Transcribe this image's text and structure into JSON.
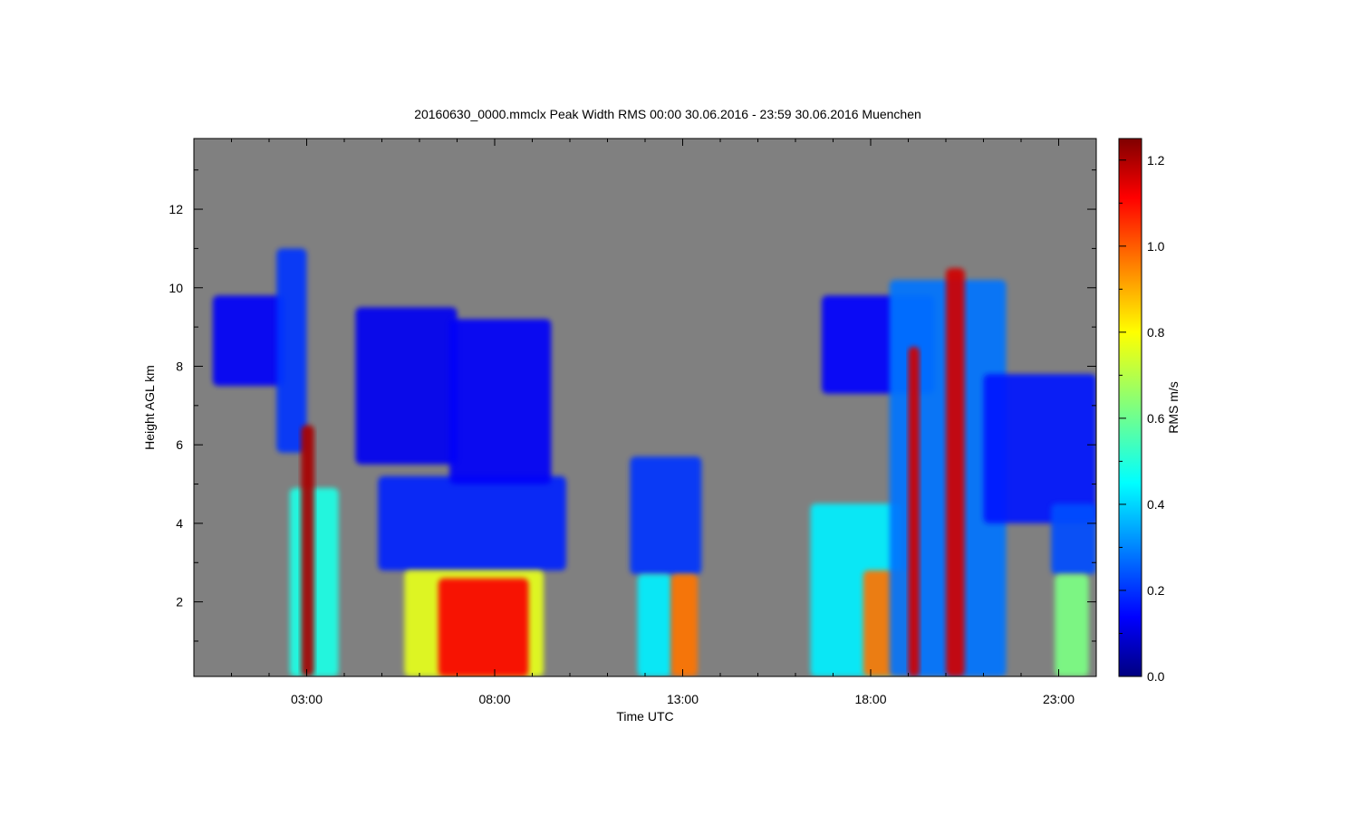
{
  "chart_data": {
    "type": "heatmap",
    "title": "20160630_0000.mmclx Peak Width RMS   00:00 30.06.2016 - 23:59 30.06.2016 Muenchen",
    "xlabel": "Time UTC",
    "ylabel": "Height AGL km",
    "x_ticks": [
      {
        "value": 3,
        "label": "03:00"
      },
      {
        "value": 8,
        "label": "08:00"
      },
      {
        "value": 13,
        "label": "13:00"
      },
      {
        "value": 18,
        "label": "18:00"
      },
      {
        "value": 23,
        "label": "23:00"
      }
    ],
    "y_ticks": [
      {
        "value": 2,
        "label": "2"
      },
      {
        "value": 4,
        "label": "4"
      },
      {
        "value": 6,
        "label": "6"
      },
      {
        "value": 8,
        "label": "8"
      },
      {
        "value": 10,
        "label": "10"
      },
      {
        "value": 12,
        "label": "12"
      }
    ],
    "xlim": [
      0,
      24
    ],
    "ylim": [
      0.1,
      13.8
    ],
    "background_color": "#808080",
    "colorbar": {
      "label": "RMS m/s",
      "range": [
        0.0,
        1.25
      ],
      "ticks": [
        {
          "value": 0.0,
          "label": "0.0"
        },
        {
          "value": 0.2,
          "label": "0.2"
        },
        {
          "value": 0.4,
          "label": "0.4"
        },
        {
          "value": 0.6,
          "label": "0.6"
        },
        {
          "value": 0.8,
          "label": "0.8"
        },
        {
          "value": 1.0,
          "label": "1.0"
        },
        {
          "value": 1.2,
          "label": "1.2"
        }
      ],
      "colormap": "jet"
    },
    "echo_regions": [
      {
        "t0": 0.5,
        "t1": 2.4,
        "h0": 7.5,
        "h1": 9.8,
        "rms": 0.15
      },
      {
        "t0": 2.2,
        "t1": 3.0,
        "h0": 5.8,
        "h1": 11.0,
        "rms": 0.22
      },
      {
        "t0": 2.55,
        "t1": 3.85,
        "h0": 0.1,
        "h1": 4.9,
        "rms": 0.5
      },
      {
        "t0": 2.85,
        "t1": 3.2,
        "h0": 0.1,
        "h1": 6.5,
        "rms": 1.2
      },
      {
        "t0": 4.3,
        "t1": 7.0,
        "h0": 5.5,
        "h1": 9.5,
        "rms": 0.14
      },
      {
        "t0": 4.9,
        "t1": 9.9,
        "h0": 2.8,
        "h1": 5.2,
        "rms": 0.2
      },
      {
        "t0": 6.8,
        "t1": 9.5,
        "h0": 5.0,
        "h1": 9.2,
        "rms": 0.15
      },
      {
        "t0": 5.6,
        "t1": 9.3,
        "h0": 0.1,
        "h1": 2.8,
        "rms": 0.75
      },
      {
        "t0": 6.5,
        "t1": 8.9,
        "h0": 0.1,
        "h1": 2.6,
        "rms": 1.1
      },
      {
        "t0": 11.6,
        "t1": 13.5,
        "h0": 2.7,
        "h1": 5.7,
        "rms": 0.22
      },
      {
        "t0": 11.8,
        "t1": 12.7,
        "h0": 0.1,
        "h1": 2.7,
        "rms": 0.45
      },
      {
        "t0": 12.7,
        "t1": 13.4,
        "h0": 0.1,
        "h1": 2.7,
        "rms": 0.95
      },
      {
        "t0": 16.7,
        "t1": 19.7,
        "h0": 7.3,
        "h1": 9.8,
        "rms": 0.16
      },
      {
        "t0": 16.4,
        "t1": 18.8,
        "h0": 0.1,
        "h1": 4.5,
        "rms": 0.45
      },
      {
        "t0": 17.8,
        "t1": 19.2,
        "h0": 0.1,
        "h1": 2.8,
        "rms": 0.95
      },
      {
        "t0": 18.5,
        "t1": 21.6,
        "h0": 0.1,
        "h1": 10.2,
        "rms": 0.3
      },
      {
        "t0": 19.0,
        "t1": 19.3,
        "h0": 0.1,
        "h1": 8.5,
        "rms": 1.15
      },
      {
        "t0": 20.0,
        "t1": 20.5,
        "h0": 0.1,
        "h1": 10.5,
        "rms": 1.15
      },
      {
        "t0": 21.0,
        "t1": 24.0,
        "h0": 4.0,
        "h1": 7.8,
        "rms": 0.18
      },
      {
        "t0": 22.8,
        "t1": 24.0,
        "h0": 2.7,
        "h1": 4.5,
        "rms": 0.25
      },
      {
        "t0": 22.9,
        "t1": 23.8,
        "h0": 0.1,
        "h1": 2.7,
        "rms": 0.62
      }
    ]
  }
}
